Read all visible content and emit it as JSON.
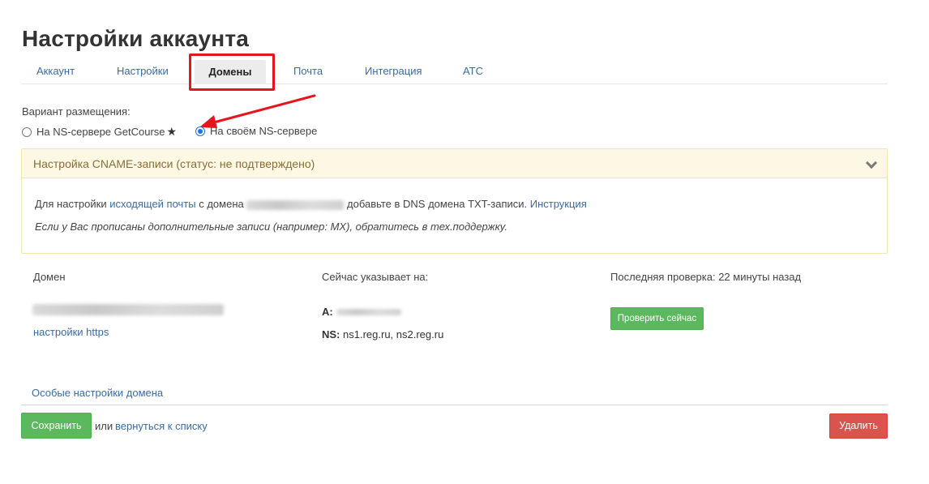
{
  "page_title": "Настройки аккаунта",
  "tabs": [
    {
      "label": "Аккаунт",
      "active": false
    },
    {
      "label": "Настройки",
      "active": false
    },
    {
      "label": "Домены",
      "active": true
    },
    {
      "label": "Почта",
      "active": false
    },
    {
      "label": "Интеграция",
      "active": false
    },
    {
      "label": "АТС",
      "active": false
    }
  ],
  "placement": {
    "label": "Вариант размещения:",
    "options": [
      {
        "label": "На NS-сервере GetCourse",
        "checked": false,
        "star": "★"
      },
      {
        "label": "На своём NS-сервере",
        "checked": true
      }
    ]
  },
  "cname": {
    "header": "Настройка CNAME-записи (статус: не подтверждено)",
    "line1_prefix": "Для настройки",
    "line1_link": "исходящей почты",
    "line1_middle": "с домена",
    "line1_suffix": "добавьте в DNS домена TXT-записи.",
    "line1_instruction": "Инструкция",
    "line2": "Если у Вас прописаны дополнительные записи (например: MX), обратитесь в тех.поддержку."
  },
  "domain_section": {
    "col_domain": "Домен",
    "col_points_to": "Сейчас указывает на:",
    "col_last_check": "Последняя проверка: 22 минуты назад",
    "https_link": "настройки https",
    "a_label": "A:",
    "ns_label": "NS:",
    "ns_value": "ns1.reg.ru, ns2.reg.ru",
    "check_button": "Проверить сейчас"
  },
  "footer": {
    "special_settings": "Особые настройки домена",
    "save": "Сохранить",
    "or": "или",
    "back_link": "вернуться к списку",
    "delete": "Удалить"
  },
  "colors": {
    "link": "#3b6ba3",
    "highlight": "#e8141c",
    "success": "#5cb85c",
    "danger": "#d9534f",
    "warning_bg": "#fcf8e3",
    "warning_text": "#8a6d3b"
  }
}
